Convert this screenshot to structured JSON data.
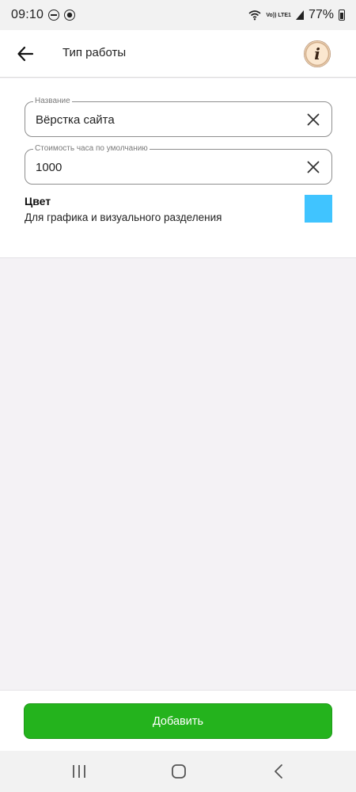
{
  "status_bar": {
    "time": "09:10",
    "network_label": "Vo)) LTE1",
    "battery": "77%"
  },
  "app_bar": {
    "title": "Тип работы",
    "back_icon": "arrow-left-icon",
    "info_icon": "info-icon"
  },
  "form": {
    "name_field": {
      "label": "Название",
      "value": "Вёрстка сайта"
    },
    "rate_field": {
      "label": "Стоимость часа по умолчанию",
      "value": "1000"
    },
    "color": {
      "title": "Цвет",
      "subtitle": "Для графика и визуального разделения",
      "swatch_color": "#40c4ff"
    }
  },
  "actions": {
    "add_label": "Добавить",
    "add_color": "#24b31d"
  },
  "nav_bar": {
    "icons": [
      "recent-apps-icon",
      "home-icon",
      "back-icon"
    ]
  }
}
